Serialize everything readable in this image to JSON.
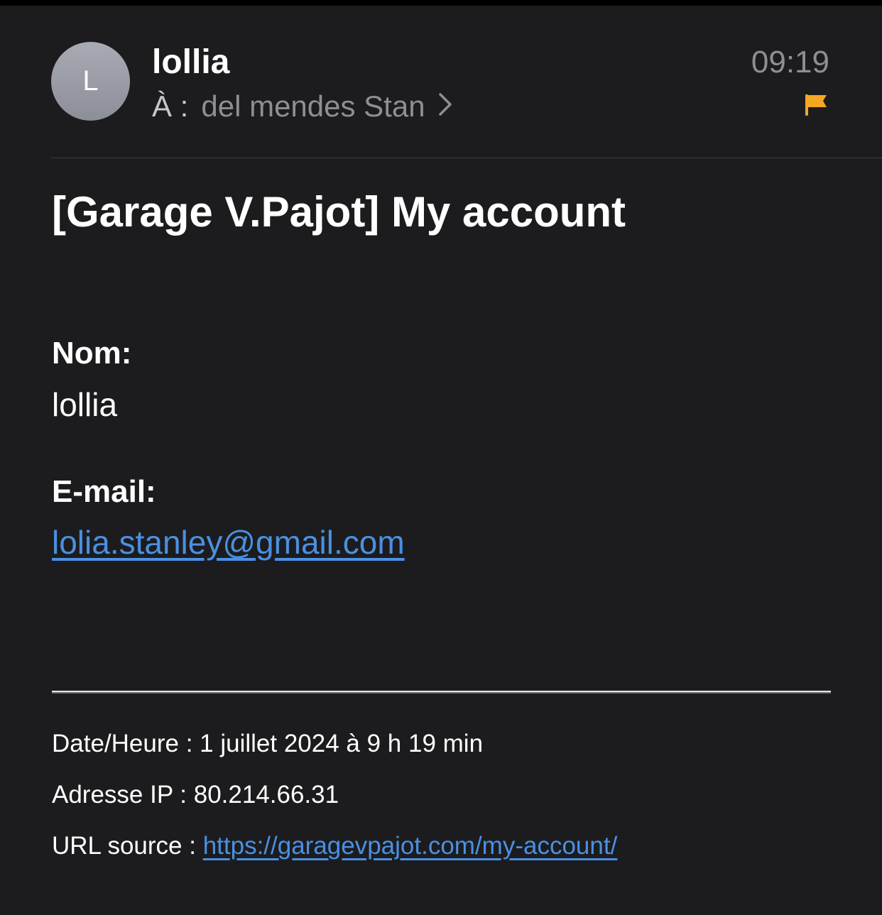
{
  "header": {
    "avatar_initial": "L",
    "sender_name": "lollia",
    "to_label": "À :",
    "recipient": "del mendes Stan",
    "time": "09:19",
    "flag_color": "#f5a623"
  },
  "message": {
    "subject": "[Garage V.Pajot] My account",
    "name_label": "Nom:",
    "name_value": "lollia",
    "email_label": "E-mail:",
    "email_value": "lolia.stanley@gmail.com",
    "datetime_label": "Date/Heure :",
    "datetime_value": "1 juillet 2024 à 9 h 19 min",
    "ip_label": "Adresse IP :",
    "ip_value": "80.214.66.31",
    "url_label": "URL source :",
    "url_value": "https://garagevpajot.com/my-account/"
  },
  "colors": {
    "background": "#1c1c1e",
    "link": "#4a90e2",
    "secondary_text": "#8e8e93"
  }
}
